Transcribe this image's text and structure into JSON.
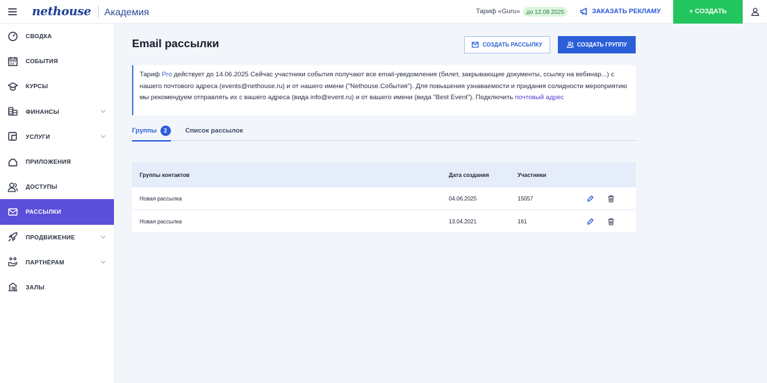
{
  "header": {
    "logo": "nethouse",
    "org_name": "Академия",
    "tariff_text": "Тариф «Guru»",
    "tariff_badge": "до 12.08.2025",
    "ads_label": "ЗАКАЗАТЬ РЕКЛАМУ",
    "create_label": "+ СОЗДАТЬ"
  },
  "sidebar": {
    "items": [
      {
        "label": "СВОДКА",
        "icon": "dashboard-icon",
        "expandable": false
      },
      {
        "label": "СОБЫТИЯ",
        "icon": "calendar-icon",
        "expandable": false
      },
      {
        "label": "КУРСЫ",
        "icon": "graduation-cap-icon",
        "expandable": false
      },
      {
        "label": "ФИНАНСЫ",
        "icon": "coins-icon",
        "expandable": true
      },
      {
        "label": "УСЛУГИ",
        "icon": "service-icon",
        "expandable": true
      },
      {
        "label": "ПРИЛОЖЕНИЯ",
        "icon": "apps-icon",
        "expandable": false
      },
      {
        "label": "ДОСТУПЫ",
        "icon": "users-icon",
        "expandable": false
      },
      {
        "label": "РАССЫЛКИ",
        "icon": "mail-icon",
        "expandable": false,
        "active": true
      },
      {
        "label": "ПРОДВИЖЕНИЕ",
        "icon": "rocket-icon",
        "expandable": true
      },
      {
        "label": "ПАРТНЁРАМ",
        "icon": "handshake-icon",
        "expandable": true
      },
      {
        "label": "ЗАЛЫ",
        "icon": "hall-icon",
        "expandable": false
      }
    ]
  },
  "main": {
    "title": "Email рассылки",
    "btn_create_mailing": "СОЗДАТЬ РАССЫЛКУ",
    "btn_create_group": "СОЗДАТЬ ГРУППУ",
    "notice": {
      "p1": "Тариф ",
      "plan": "Pro",
      "p2": " действует до 14.06.2025 Сейчас участники события получают все email-уведомления (билет, закрывающие документы, ссылку на вебинар...) с нашего почтового адреса (events@nethouse.ru) и от нашего имени (\"Nethouse.События\"). Для повышения узнаваемости и придания солидности мероприятию мы рекомендуем отправлять их с вашего адреса (вида info@event.ru) и от вашего имени (вида \"Best Event\"). Подключить ",
      "link": "почтовый адрес"
    },
    "tabs": [
      {
        "label": "Группы",
        "count": "2",
        "active": true
      },
      {
        "label": "Список рассылок",
        "active": false
      }
    ],
    "table": {
      "headers": [
        "Группы контактов",
        "Дата создания",
        "Участники"
      ],
      "rows": [
        {
          "name": "Новая рассылка",
          "date": "04.06.2025",
          "members": "15057"
        },
        {
          "name": "Новая рассылка",
          "date": "13.04.2021",
          "members": "161"
        }
      ]
    }
  },
  "colors": {
    "accent": "#2b5fd9",
    "sidebar_active": "#5a4fd9",
    "create_green": "#22c55e"
  }
}
